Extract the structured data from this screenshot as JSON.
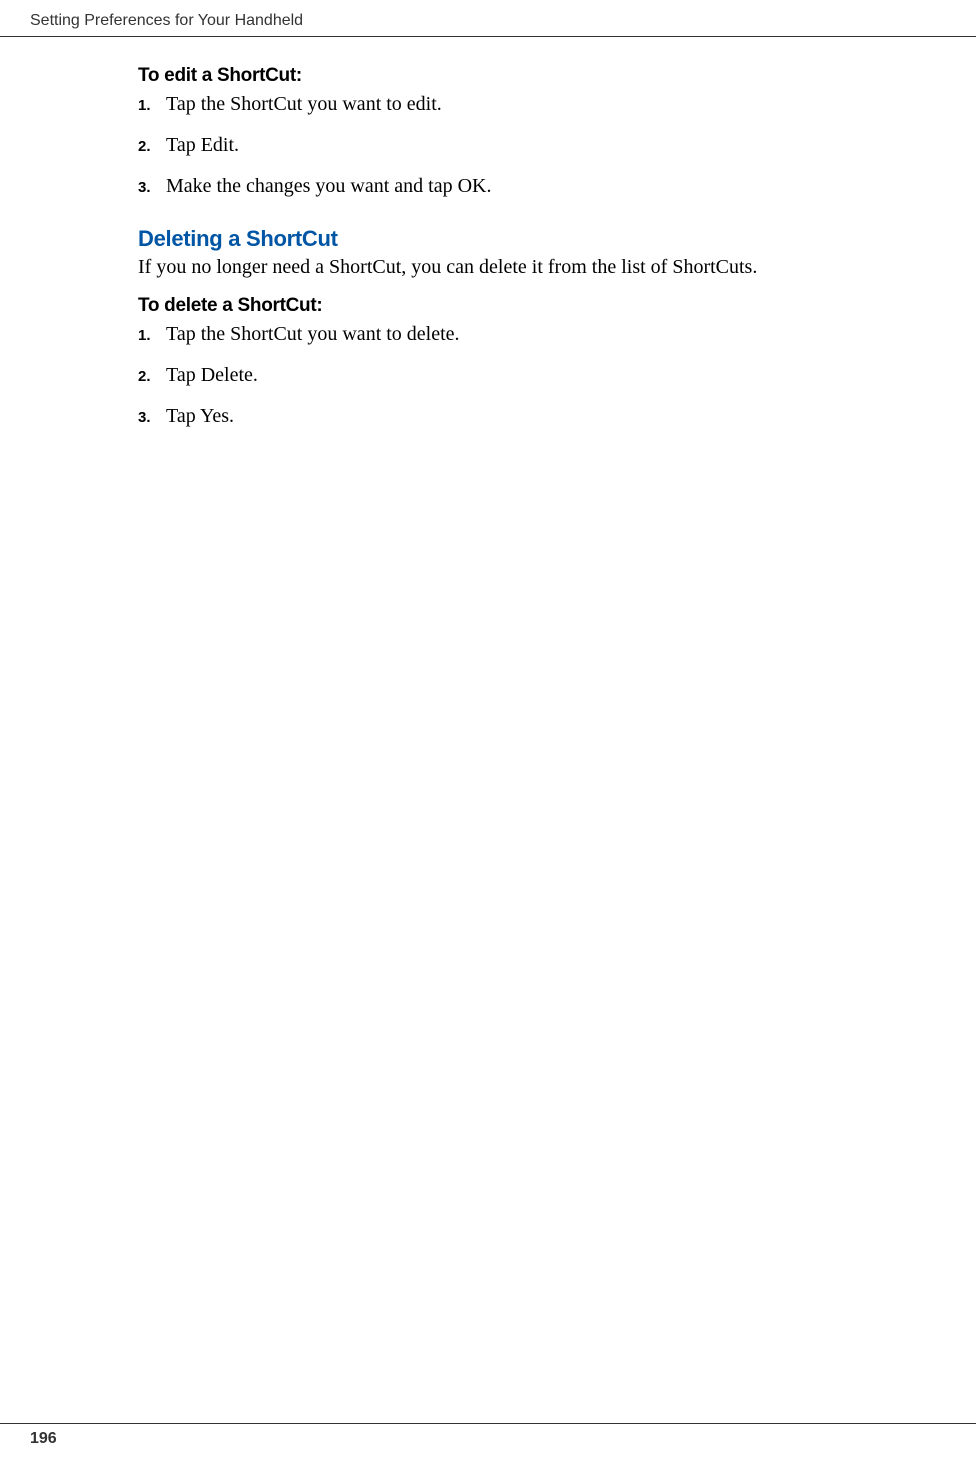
{
  "header": {
    "title": "Setting Preferences for Your Handheld"
  },
  "sections": {
    "edit": {
      "heading": "To edit a ShortCut:",
      "steps": [
        {
          "num": "1.",
          "text": "Tap the ShortCut you want to edit."
        },
        {
          "num": "2.",
          "text": "Tap Edit."
        },
        {
          "num": "3.",
          "text": "Make the changes you want and tap OK."
        }
      ]
    },
    "delete": {
      "title": "Deleting a ShortCut",
      "intro": "If you no longer need a ShortCut, you can delete it from the list of ShortCuts.",
      "heading": "To delete a ShortCut:",
      "steps": [
        {
          "num": "1.",
          "text": "Tap the ShortCut you want to delete."
        },
        {
          "num": "2.",
          "text": "Tap Delete."
        },
        {
          "num": "3.",
          "text": "Tap Yes."
        }
      ]
    }
  },
  "footer": {
    "pageNumber": "196"
  }
}
